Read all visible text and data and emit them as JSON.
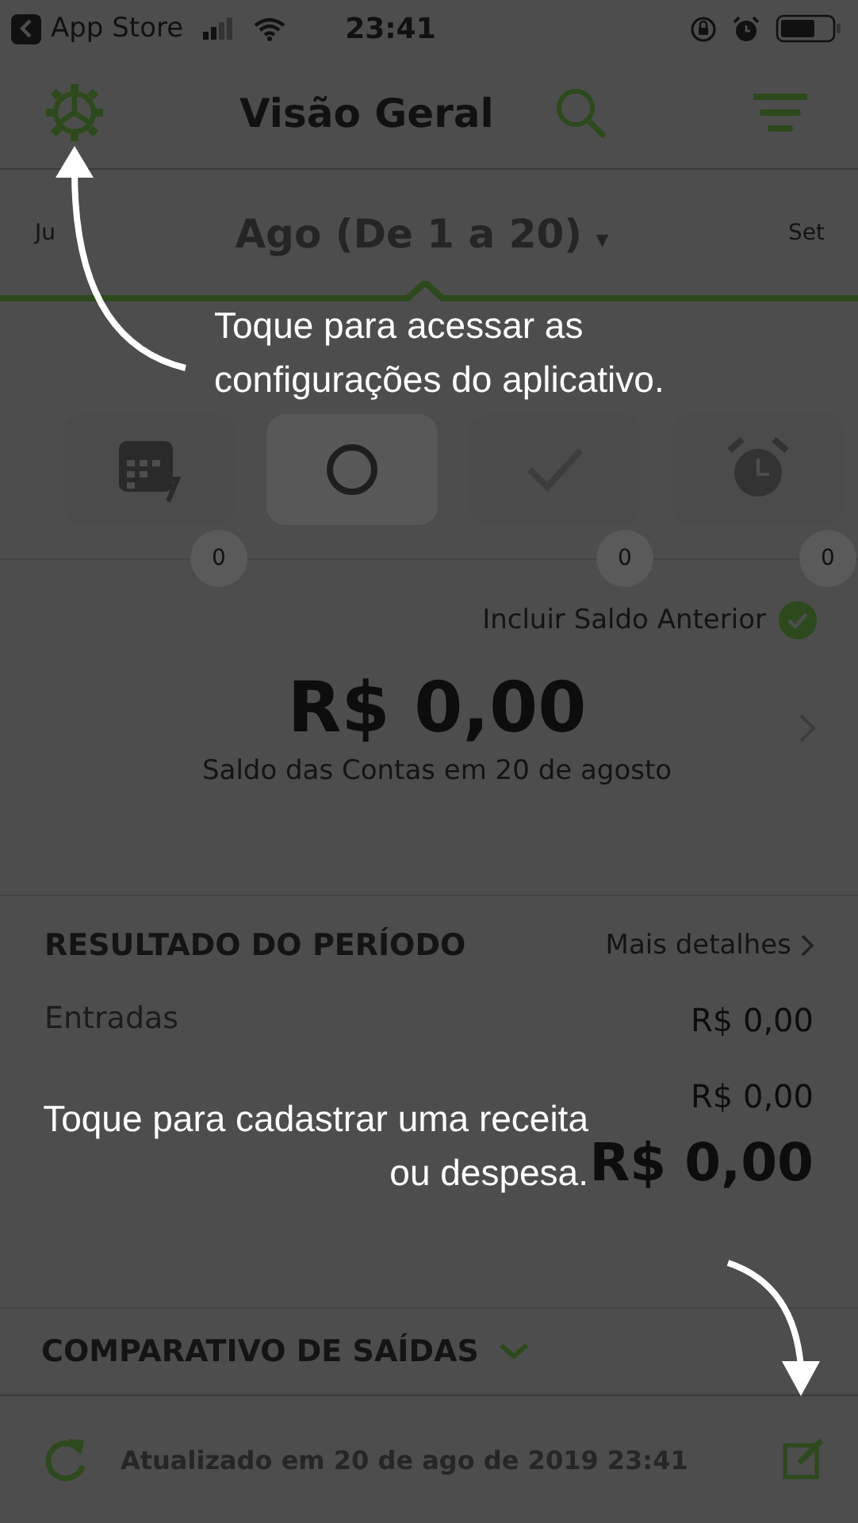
{
  "status_bar": {
    "back_label": "App Store",
    "time": "23:41"
  },
  "nav": {
    "title": "Visão Geral"
  },
  "period": {
    "previous": "Ju",
    "current": "Ago (De 1 a 20)",
    "dropdown": "▾",
    "next": "Set"
  },
  "summary": [
    {
      "badge": "0",
      "selected": false
    },
    {
      "selected": true
    },
    {
      "badge": "0",
      "selected": false
    },
    {
      "badge": "0",
      "selected": false
    }
  ],
  "balance": {
    "include_label": "Incluir Saldo Anterior",
    "include_checked": true,
    "amount": "R$ 0,00",
    "caption": "Saldo das Contas em 20 de agosto"
  },
  "result": {
    "title": "RESULTADO DO PERÍODO",
    "link": "Mais detalhes",
    "rows": [
      {
        "label": "Entradas",
        "value": "R$ 0,00"
      },
      {
        "value": "R$ 0,00"
      }
    ],
    "total": "R$ 0,00"
  },
  "comparison": {
    "title": "COMPARATIVO DE SAÍDAS",
    "expanded": false
  },
  "footer": {
    "updated": "Atualizado em 20 de ago de 2019 23:41"
  },
  "tips": [
    {
      "lines": [
        "Toque para acessar as",
        "configurações do aplicativo."
      ]
    },
    {
      "lines": [
        "Toque para cadastrar uma receita",
        "ou despesa."
      ]
    }
  ]
}
